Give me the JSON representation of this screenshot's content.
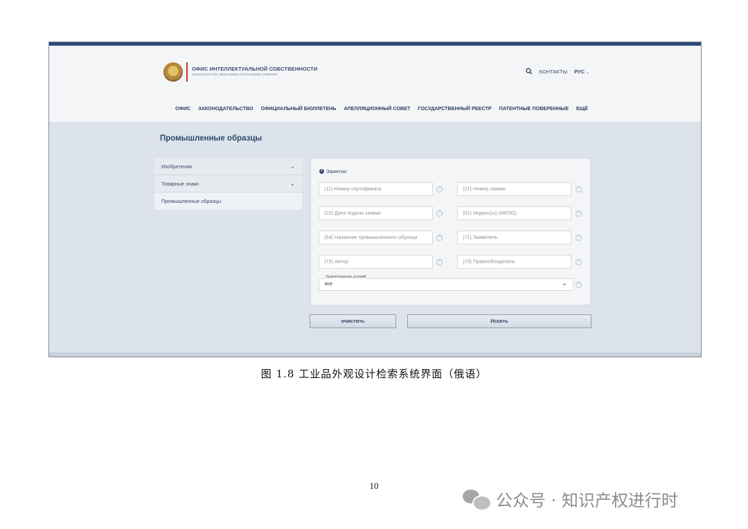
{
  "site": {
    "office_title": "ОФИС ИНТЕЛЛЕКТУАЛЬНОЙ СОБСТВЕННОСТИ",
    "office_subtitle": "МИНИСТЕРСТВО ЭКОНОМИКИ РЕСПУБЛИКИ АРМЕНИЯ",
    "contacts": "КОНТАКТЫ",
    "language": "РУС"
  },
  "nav": [
    "ОФИС",
    "ЗАКОНОДАТЕЛЬСТВО",
    "ОФИЦИАЛЬНЫЙ БЮЛЛЕТЕНЬ",
    "АПЕЛЛЯЦИОННЫЙ СОВЕТ",
    "ГОСУДАРСТВЕННЫЙ РЕЕСТР",
    "ПАТЕНТНЫЕ ПОВЕРЕННЫЕ",
    "ЕЩЁ"
  ],
  "page_title": "Промышленные образцы",
  "sidebar": [
    {
      "label": "Изобретения"
    },
    {
      "label": "Товарные знаки"
    },
    {
      "label": "Промышленные образцы"
    }
  ],
  "form": {
    "notes_label": "Заметки:",
    "fields": [
      {
        "placeholder": "(11) Номер сертификата"
      },
      {
        "placeholder": "(21) Номер заявки"
      },
      {
        "placeholder": "(22) Дата подачи заявки"
      },
      {
        "placeholder": "(51) Индекс(ы) (МКПО)"
      },
      {
        "placeholder": "(54) Название промышленного образца"
      },
      {
        "placeholder": "(71) Заявитель"
      },
      {
        "placeholder": "(72) Автор"
      },
      {
        "placeholder": "(73) Правообладатель"
      }
    ],
    "select": {
      "legend": "Удовлетворение условий",
      "value": "все"
    },
    "clear_button": "очистить",
    "search_button": "Искать"
  },
  "caption": "图 1.8 工业品外观设计检索系统界面（俄语）",
  "page_number": "10",
  "watermark": "公众号 · 知识产权进行时"
}
